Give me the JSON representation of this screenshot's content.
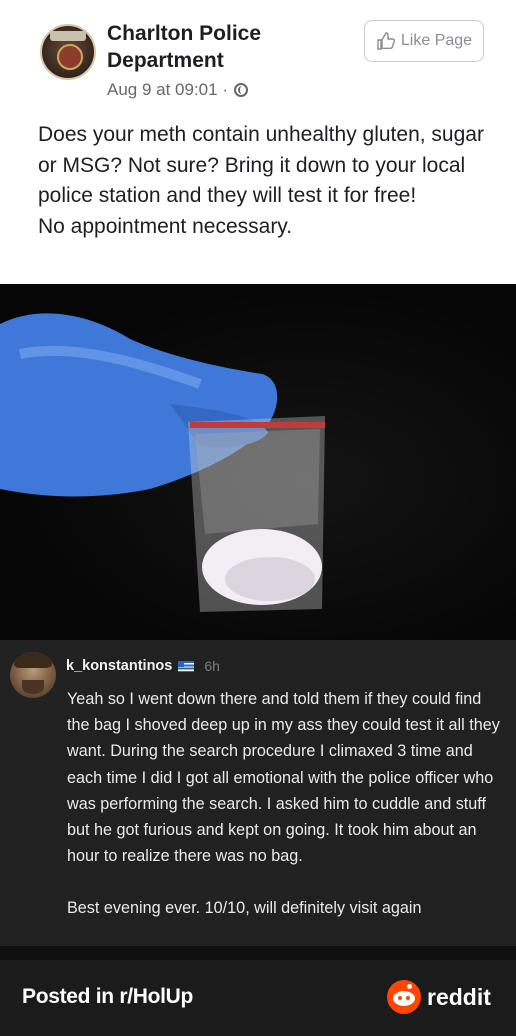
{
  "post": {
    "page_name": "Charlton Police Department",
    "date": "Aug 9 at 09:01 ·",
    "like_button": "Like Page",
    "text_lines": [
      "Does your meth contain unhealthy gluten, sugar or MSG? Not sure? Bring it down to your local police station and they will test it for free!",
      "No appointment necessary."
    ],
    "avatar_icon": "police-badge-icon",
    "privacy_icon": "globe-icon"
  },
  "photo": {
    "description_icon": "gloved-hand-holding-bag"
  },
  "comment": {
    "username": "k_konstantinos",
    "flag_icon": "greek-flag-icon",
    "time": "6h",
    "paragraphs": [
      "Yeah so I went down there and told them if they could find the bag I shoved deep up in my ass they could test it all they want. During the search procedure I climaxed 3 time and each time I did I got all emotional with the police officer who was performing the search. I asked him to cuddle and stuff but he got furious and kept on going. It took him about an hour to realize there was no bag.",
      "Best evening ever. 10/10, will definitely visit again"
    ]
  },
  "footer": {
    "posted_in": "Posted in r/HolUp",
    "brand": "reddit",
    "brand_color": "#ff4500"
  }
}
